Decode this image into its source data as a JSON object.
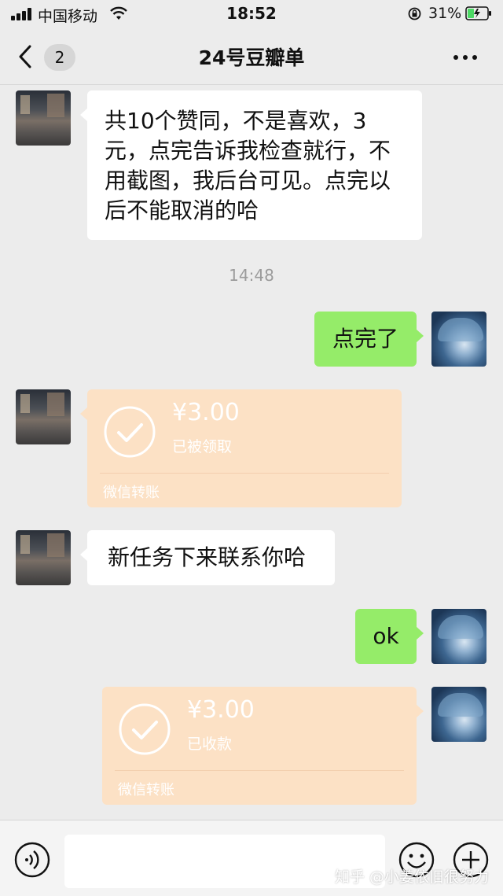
{
  "status_bar": {
    "carrier": "中国移动",
    "time": "18:52",
    "battery": "31%"
  },
  "header": {
    "back_badge": "2",
    "title": "24号豆瓣单"
  },
  "messages": [
    {
      "side": "left",
      "type": "text",
      "text": "共10个赞同，不是喜欢，3元，点完告诉我检查就行，不用截图，我后台可见。点完以后不能取消的哈"
    },
    {
      "type": "time",
      "text": "14:48"
    },
    {
      "side": "right",
      "type": "text",
      "text": "点完了"
    },
    {
      "side": "left",
      "type": "transfer",
      "amount": "¥3.00",
      "status": "已被领取",
      "label": "微信转账"
    },
    {
      "side": "left",
      "type": "text",
      "text": "新任务下来联系你哈"
    },
    {
      "side": "right",
      "type": "text",
      "text": "ok"
    },
    {
      "side": "right",
      "type": "transfer",
      "amount": "¥3.00",
      "status": "已收款",
      "label": "微信转账"
    }
  ],
  "watermark": "知乎 @小姜依旧很努力",
  "colors": {
    "background": "#ececec",
    "bubble_self": "#95ec69",
    "bubble_other": "#ffffff",
    "transfer_card": "#fce1c5"
  }
}
